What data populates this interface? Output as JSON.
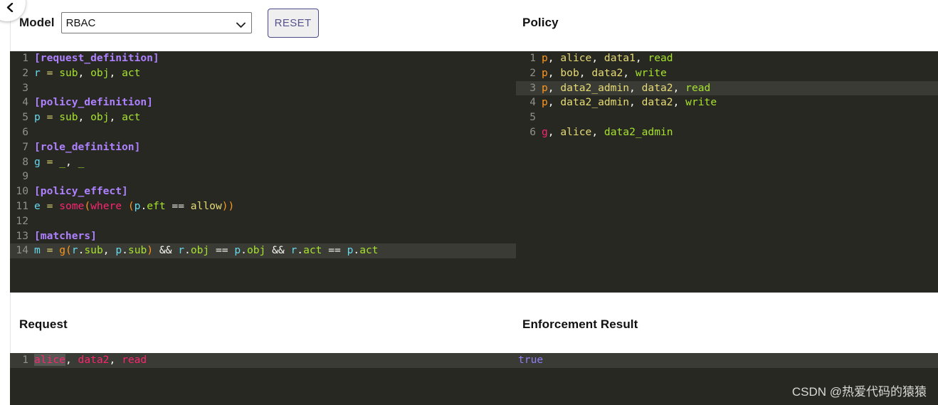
{
  "back_button": {
    "icon": "chevron-left-icon"
  },
  "toolbar": {
    "model_label": "Model",
    "model_selected": "RBAC",
    "model_options": [
      "RBAC"
    ],
    "reset_label": "RESET",
    "dropdown_icon": "chevron-down-icon",
    "reset_border_color": "#4c4a86",
    "reset_text_color": "#55538c"
  },
  "sections": {
    "policy_title": "Policy",
    "request_title": "Request",
    "result_title": "Enforcement Result"
  },
  "editor_theme": {
    "background": "#272822",
    "active_line": "#3a3b34",
    "gutter_text": "#90918b",
    "selection": "#555753"
  },
  "model_editor": {
    "active_line": 14,
    "lines": [
      {
        "n": "1",
        "text": "[request_definition]"
      },
      {
        "n": "2",
        "text": "r = sub, obj, act"
      },
      {
        "n": "3",
        "text": ""
      },
      {
        "n": "4",
        "text": "[policy_definition]"
      },
      {
        "n": "5",
        "text": "p = sub, obj, act"
      },
      {
        "n": "6",
        "text": ""
      },
      {
        "n": "7",
        "text": "[role_definition]"
      },
      {
        "n": "8",
        "text": "g = _, _"
      },
      {
        "n": "9",
        "text": ""
      },
      {
        "n": "10",
        "text": "[policy_effect]"
      },
      {
        "n": "11",
        "text": "e = some(where (p.eft == allow))"
      },
      {
        "n": "12",
        "text": ""
      },
      {
        "n": "13",
        "text": "[matchers]"
      },
      {
        "n": "14",
        "text": "m = g(r.sub, p.sub) && r.obj == p.obj && r.act == p.act"
      }
    ]
  },
  "policy_editor": {
    "active_line": 3,
    "lines": [
      {
        "n": "1",
        "text": "p, alice, data1, read"
      },
      {
        "n": "2",
        "text": "p, bob, data2, write"
      },
      {
        "n": "3",
        "text": "p, data2_admin, data2, read"
      },
      {
        "n": "4",
        "text": "p, data2_admin, data2, write"
      },
      {
        "n": "5",
        "text": ""
      },
      {
        "n": "6",
        "text": "g, alice, data2_admin"
      }
    ]
  },
  "request_editor": {
    "active_line": 1,
    "selected_token": "alice",
    "lines": [
      {
        "n": "1",
        "text": "alice, data2, read"
      }
    ]
  },
  "result_editor": {
    "active_line": 1,
    "lines": [
      {
        "n": "",
        "text": "true"
      }
    ]
  },
  "watermark": {
    "text": "CSDN @热爱代码的猿猿"
  }
}
